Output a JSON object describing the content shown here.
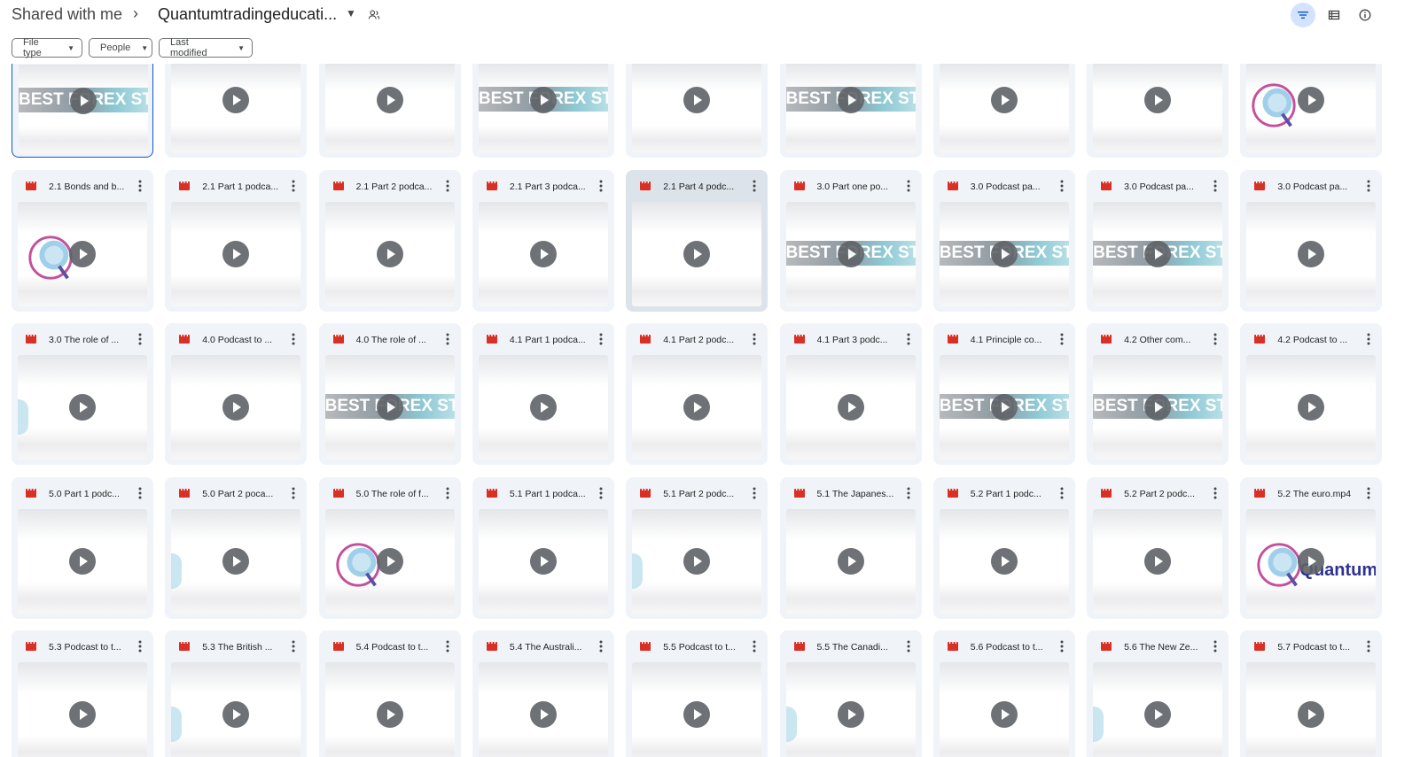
{
  "breadcrumb": {
    "root": "Shared with me",
    "separator": "›",
    "folder": "Quantumtradingeducati..."
  },
  "filters": [
    {
      "label": "File type",
      "width": 80
    },
    {
      "label": "People",
      "width": 72
    },
    {
      "label": "Last modified",
      "width": 106
    }
  ],
  "colors": {
    "accent": "#0b57d0",
    "video": "#d93025",
    "card_bg": "#f0f4f9"
  },
  "top_row": [
    "forex",
    "plain",
    "plain",
    "forex",
    "plain",
    "forex",
    "plain",
    "plain",
    "quantum"
  ],
  "rows": [
    [
      {
        "name": "2.1 Bonds and b...",
        "thumb": "quantum"
      },
      {
        "name": "2.1 Part 1 podca...",
        "thumb": "plain"
      },
      {
        "name": "2.1 Part 2 podca...",
        "thumb": "plain"
      },
      {
        "name": "2.1 Part 3 podca...",
        "thumb": "plain"
      },
      {
        "name": "2.1 Part 4 podc...",
        "thumb": "plain",
        "hover": true
      },
      {
        "name": "3.0 Part one po...",
        "thumb": "forex"
      },
      {
        "name": "3.0 Podcast pa...",
        "thumb": "forex"
      },
      {
        "name": "3.0 Podcast pa...",
        "thumb": "forex"
      },
      {
        "name": "3.0 Podcast pa...",
        "thumb": "plain"
      }
    ],
    [
      {
        "name": "3.0 The role of ...",
        "thumb": "partial"
      },
      {
        "name": "4.0 Podcast to ...",
        "thumb": "plain"
      },
      {
        "name": "4.0 The role of ...",
        "thumb": "forex"
      },
      {
        "name": "4.1 Part 1 podca...",
        "thumb": "plain"
      },
      {
        "name": "4.1 Part 2 podc...",
        "thumb": "plain"
      },
      {
        "name": "4.1 Part 3 podc...",
        "thumb": "plain"
      },
      {
        "name": "4.1 Principle co...",
        "thumb": "forex"
      },
      {
        "name": "4.2 Other com...",
        "thumb": "forex"
      },
      {
        "name": "4.2 Podcast to ...",
        "thumb": "plain"
      }
    ],
    [
      {
        "name": "5.0 Part 1 podc...",
        "thumb": "plain"
      },
      {
        "name": "5.0 Part 2 poca...",
        "thumb": "partial"
      },
      {
        "name": "5.0 The role of f...",
        "thumb": "quantum"
      },
      {
        "name": "5.1 Part 1 podca...",
        "thumb": "plain"
      },
      {
        "name": "5.1 Part 2 podc...",
        "thumb": "partial"
      },
      {
        "name": "5.1 The Japanes...",
        "thumb": "plain"
      },
      {
        "name": "5.2 Part 1 podc...",
        "thumb": "plain"
      },
      {
        "name": "5.2 Part 2 podc...",
        "thumb": "plain"
      },
      {
        "name": "5.2 The euro.mp4",
        "thumb": "quantumtext"
      }
    ],
    [
      {
        "name": "5.3 Podcast to t...",
        "thumb": "plain"
      },
      {
        "name": "5.3 The British ...",
        "thumb": "partial"
      },
      {
        "name": "5.4 Podcast to t...",
        "thumb": "plain"
      },
      {
        "name": "5.4 The Australi...",
        "thumb": "plain"
      },
      {
        "name": "5.5 Podcast to t...",
        "thumb": "plain"
      },
      {
        "name": "5.5 The Canadi...",
        "thumb": "partial"
      },
      {
        "name": "5.6 Podcast to t...",
        "thumb": "plain"
      },
      {
        "name": "5.6 The New Ze...",
        "thumb": "partial"
      },
      {
        "name": "5.7 Podcast to t...",
        "thumb": "plain"
      }
    ]
  ],
  "thumb_text": {
    "forex": "BEST FOREX STORE",
    "quantum": "Quantum"
  }
}
